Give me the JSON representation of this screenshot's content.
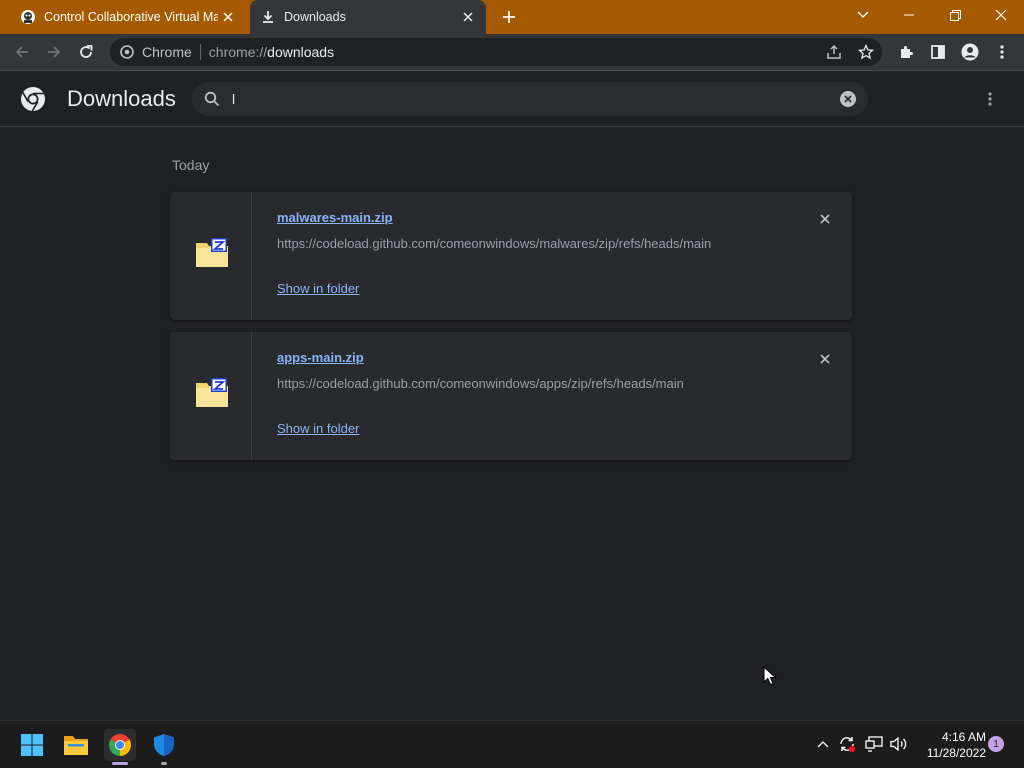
{
  "tabs": [
    {
      "title": "Control Collaborative Virtual Mac",
      "active": false
    },
    {
      "title": "Downloads",
      "active": true
    }
  ],
  "omnibox": {
    "site_name": "Chrome",
    "scheme": "chrome://",
    "host": "downloads"
  },
  "page": {
    "title": "Downloads",
    "search_value": "l",
    "section_label": "Today"
  },
  "downloads": [
    {
      "filename": "malwares-main.zip",
      "url": "https://codeload.github.com/comeonwindows/malwares/zip/refs/heads/main",
      "action": "Show in folder"
    },
    {
      "filename": "apps-main.zip",
      "url": "https://codeload.github.com/comeonwindows/apps/zip/refs/heads/main",
      "action": "Show in folder"
    }
  ],
  "taskbar": {
    "time": "4:16 AM",
    "date": "11/28/2022",
    "notification_count": "1"
  },
  "colors": {
    "tabstrip": "#a65a00",
    "toolbar": "#35363a",
    "page_bg": "#202124",
    "link": "#8ab4f8"
  }
}
